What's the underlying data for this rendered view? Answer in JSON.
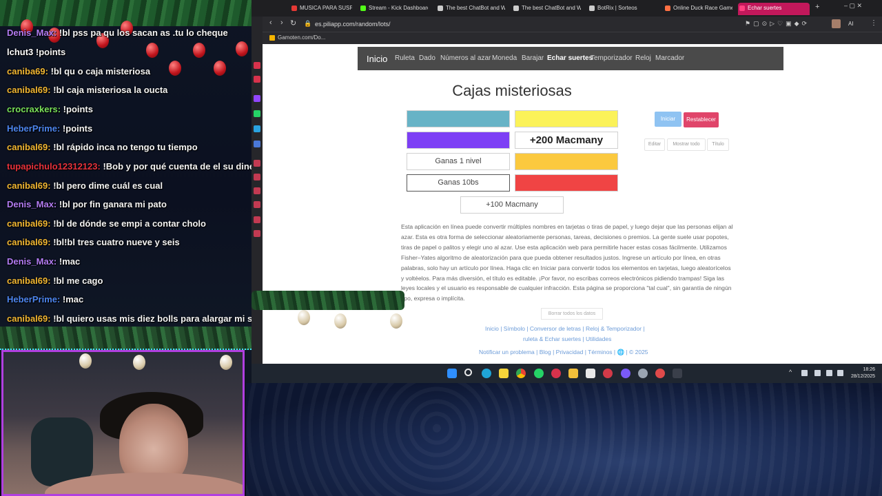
{
  "chat": {
    "messages": [
      {
        "user": "Denis_Max:",
        "text": "!bl pss pa qu los sacan as .tu lo cheque",
        "color": "#b37cf3"
      },
      {
        "user": "lchut3",
        "text": "!points",
        "color": "#ffffff"
      },
      {
        "user": "caniba69:",
        "text": "!bl qu o caja misteriosa",
        "color": "#f2b733"
      },
      {
        "user": "canibal69:",
        "text": "!bl caja misteriosa la oucta",
        "color": "#f2b733"
      },
      {
        "user": "crocraxkers:",
        "text": "!points",
        "color": "#79e05a"
      },
      {
        "user": "HeberPrime:",
        "text": "!points",
        "color": "#4d86f0"
      },
      {
        "user": "canibal69:",
        "text": "!bl rápido inca no tengo tu tiempo",
        "color": "#f2b733"
      },
      {
        "user": "tupapichulo12312123:",
        "text": "!Bob y por qué cuenta de el su dinero",
        "color": "#e8323c"
      },
      {
        "user": "canibal69:",
        "text": "!bl pero dime cuál es cual",
        "color": "#f2b733"
      },
      {
        "user": "Denis_Max:",
        "text": "!bl por fin ganara mi pato",
        "color": "#b37cf3"
      },
      {
        "user": "canibal69:",
        "text": "!bl de dónde se empi a contar cholo",
        "color": "#f2b733"
      },
      {
        "user": "canibal69:",
        "text": "!bl!bl tres cuatro nueve y seis",
        "color": "#f2b733"
      },
      {
        "user": "Denis_Max:",
        "text": "!mac",
        "color": "#b37cf3"
      },
      {
        "user": "canibal69:",
        "text": "!bl me cago",
        "color": "#f2b733"
      },
      {
        "user": "HeberPrime:",
        "text": "!mac",
        "color": "#4d86f0"
      },
      {
        "user": "canibal69:",
        "text": "!bl quiero usas mis diez bolls para alargar mi sub",
        "color": "#f2b733"
      }
    ]
  },
  "browser": {
    "tabs": [
      "MUSICA PARA SUSPE",
      "Stream - Kick Dashboard",
      "The best ChatBot and Wi",
      "The best ChatBot and Wi",
      "BotRix | Sorteos",
      "Online Duck Race Game",
      "Echar suertes"
    ],
    "url": "es.piliapp.com/random/lots/",
    "bookmark": "Gamoten.com/Do...",
    "ai_label": "AI"
  },
  "site": {
    "brand": "Inicio",
    "nav": [
      "Ruleta",
      "Dado",
      "Números al azar",
      "Moneda",
      "Barajar",
      "Echar suertes",
      "Temporizador",
      "Reloj",
      "Marcador"
    ],
    "title": "Cajas misteriosas",
    "boxes": {
      "b1": "",
      "b2": "",
      "b3": "",
      "b4": "+200 Macmany",
      "b5": "Ganas 1 nivel",
      "b6": "",
      "b7": "Ganas 10bs",
      "b8": "",
      "b9": "+100 Macmany"
    },
    "box_colors": {
      "teal": "#67b3c6",
      "yellow": "#fbf259",
      "purple": "#7d3ff5",
      "gold": "#fbc93f",
      "red": "#f04444"
    },
    "buttons": {
      "start": "Iniciar",
      "reset": "Restablecer",
      "edit": "Editar",
      "show_all": "Mostrar todo",
      "title": "Título"
    },
    "description": "Esta aplicación en línea puede convertir múltiples nombres en tarjetas o tiras de papel, y luego dejar que las personas elijan al azar. Esta es otra forma de seleccionar aleatoriamente personas, tareas, decisiones o premios. La gente suele usar popotes, tiras de papel o palitos y elegir uno al azar. Use esta aplicación web para permitirle hacer estas cosas fácilmente. Utilizamos Fisher–Yates algoritmo de aleatorización para que pueda obtener resultados justos. Ingrese un artículo por línea, en otras palabras, solo hay un artículo por línea. Haga clic en Iniciar para convertir todos los elementos en tarjetas, luego aleatorícelos y voltéelos. Para más diversión, el título es editable. ¡Por favor, no escribas correos electrónicos pidiendo trampas! Siga las leyes locales y el usuario es responsable de cualquier infracción. Esta página se proporciona \"tal cual\", sin garantía de ningún tipo, expresa o implícita.",
    "clear_all": "Borrar todos los datos",
    "footer": {
      "line1": "Inicio | Símbolo | Conversor de letras | Reloj & Temporizador |",
      "line2": "ruleta & Echar suertes | Utilidades",
      "line3": "Notificar un problema | Blog | Privacidad | Términos | 🌐 | © 2025"
    }
  },
  "taskbar": {
    "time": "18:26",
    "date": "28/12/2025"
  }
}
